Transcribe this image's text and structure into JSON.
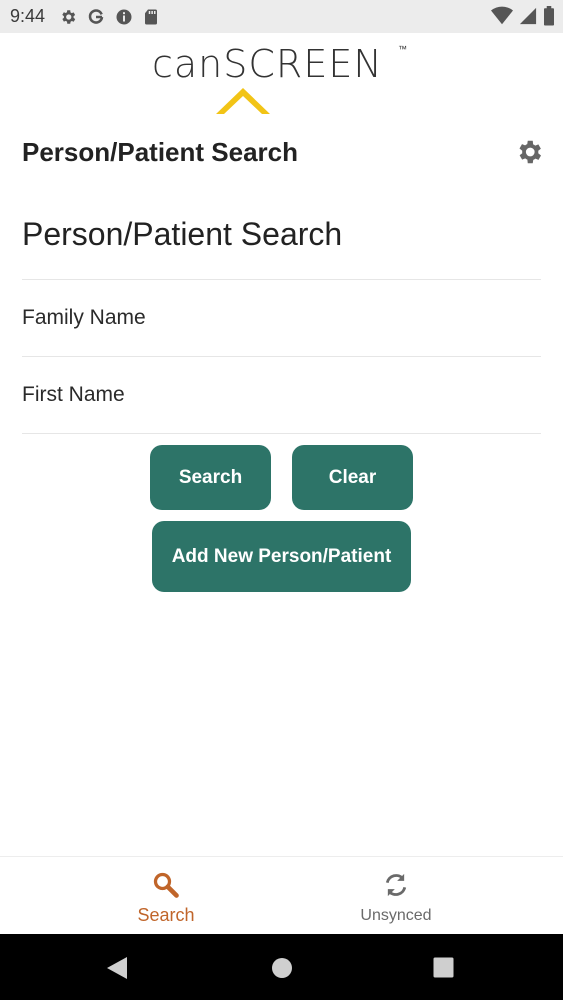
{
  "status_bar": {
    "time": "9:44",
    "left_icons": [
      "settings-gear-icon",
      "google-g-icon",
      "info-icon",
      "sd-card-icon"
    ],
    "right_icons": [
      "wifi-icon",
      "cell-signal-icon",
      "battery-icon"
    ]
  },
  "logo": {
    "text": "canSCREEN",
    "trademark": "™",
    "accent_color": "#f2c416"
  },
  "header": {
    "title": "Person/Patient Search"
  },
  "form": {
    "heading": "Person/Patient Search",
    "family_name": {
      "placeholder": "Family Name",
      "value": ""
    },
    "first_name": {
      "placeholder": "First Name",
      "value": ""
    }
  },
  "buttons": {
    "search": "Search",
    "clear": "Clear",
    "add_new": "Add New Person/Patient"
  },
  "bottom_nav": {
    "items": [
      {
        "label": "Search",
        "icon": "magnifier-icon",
        "active": true
      },
      {
        "label": "Unsynced",
        "icon": "sync-icon",
        "active": false
      }
    ]
  },
  "colors": {
    "primary": "#2d7468",
    "active_tab": "#c0652a",
    "inactive_tab": "#6a6a6a",
    "status_bar": "#ececec"
  }
}
